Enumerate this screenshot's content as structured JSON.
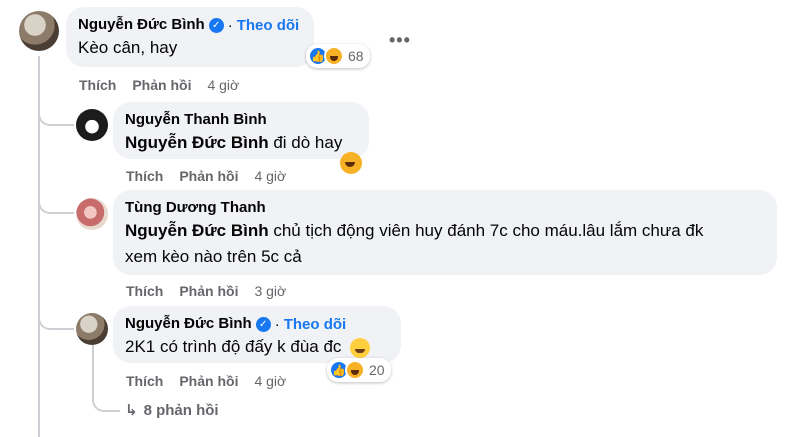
{
  "comments": [
    {
      "author": "Nguyễn Đức Bình",
      "verified": true,
      "follow_label": "Theo dõi",
      "text": "Kèo cân, hay",
      "actions": {
        "like": "Thích",
        "reply": "Phản hồi",
        "time": "4 giờ"
      },
      "reactions": {
        "icons": [
          "like",
          "haha"
        ],
        "count": "68"
      }
    },
    {
      "author": "Nguyễn Thanh Bình",
      "mention": "Nguyễn Đức Bình",
      "text": "đi dò hay",
      "actions": {
        "like": "Thích",
        "reply": "Phản hồi",
        "time": "4 giờ"
      }
    },
    {
      "author": "Tùng Dương Thanh",
      "mention": "Nguyễn Đức Bình",
      "text_line1": "chủ tịch động viên huy đánh 7c cho máu.lâu lắm chưa đk",
      "text_line2": "xem kèo nào trên 5c cả",
      "actions": {
        "like": "Thích",
        "reply": "Phản hồi",
        "time": "3 giờ"
      }
    },
    {
      "author": "Nguyễn Đức Bình",
      "verified": true,
      "follow_label": "Theo dõi",
      "text": "2K1 có trình độ đấy k đùa đc",
      "actions": {
        "like": "Thích",
        "reply": "Phản hồi",
        "time": "4 giờ"
      },
      "reactions": {
        "icons": [
          "like",
          "haha"
        ],
        "count": "20"
      }
    }
  ],
  "more_replies": {
    "arrow": "↳",
    "label": "8 phản hồi"
  },
  "separator": "·",
  "colors": {
    "accent": "#1877f2",
    "bubble": "#f0f2f5",
    "muted": "#65676b"
  },
  "icons": [
    "more-options-icon",
    "verified-icon",
    "like-reaction-icon",
    "haha-reaction-icon",
    "smile-emoji-icon",
    "reply-arrow-icon"
  ]
}
